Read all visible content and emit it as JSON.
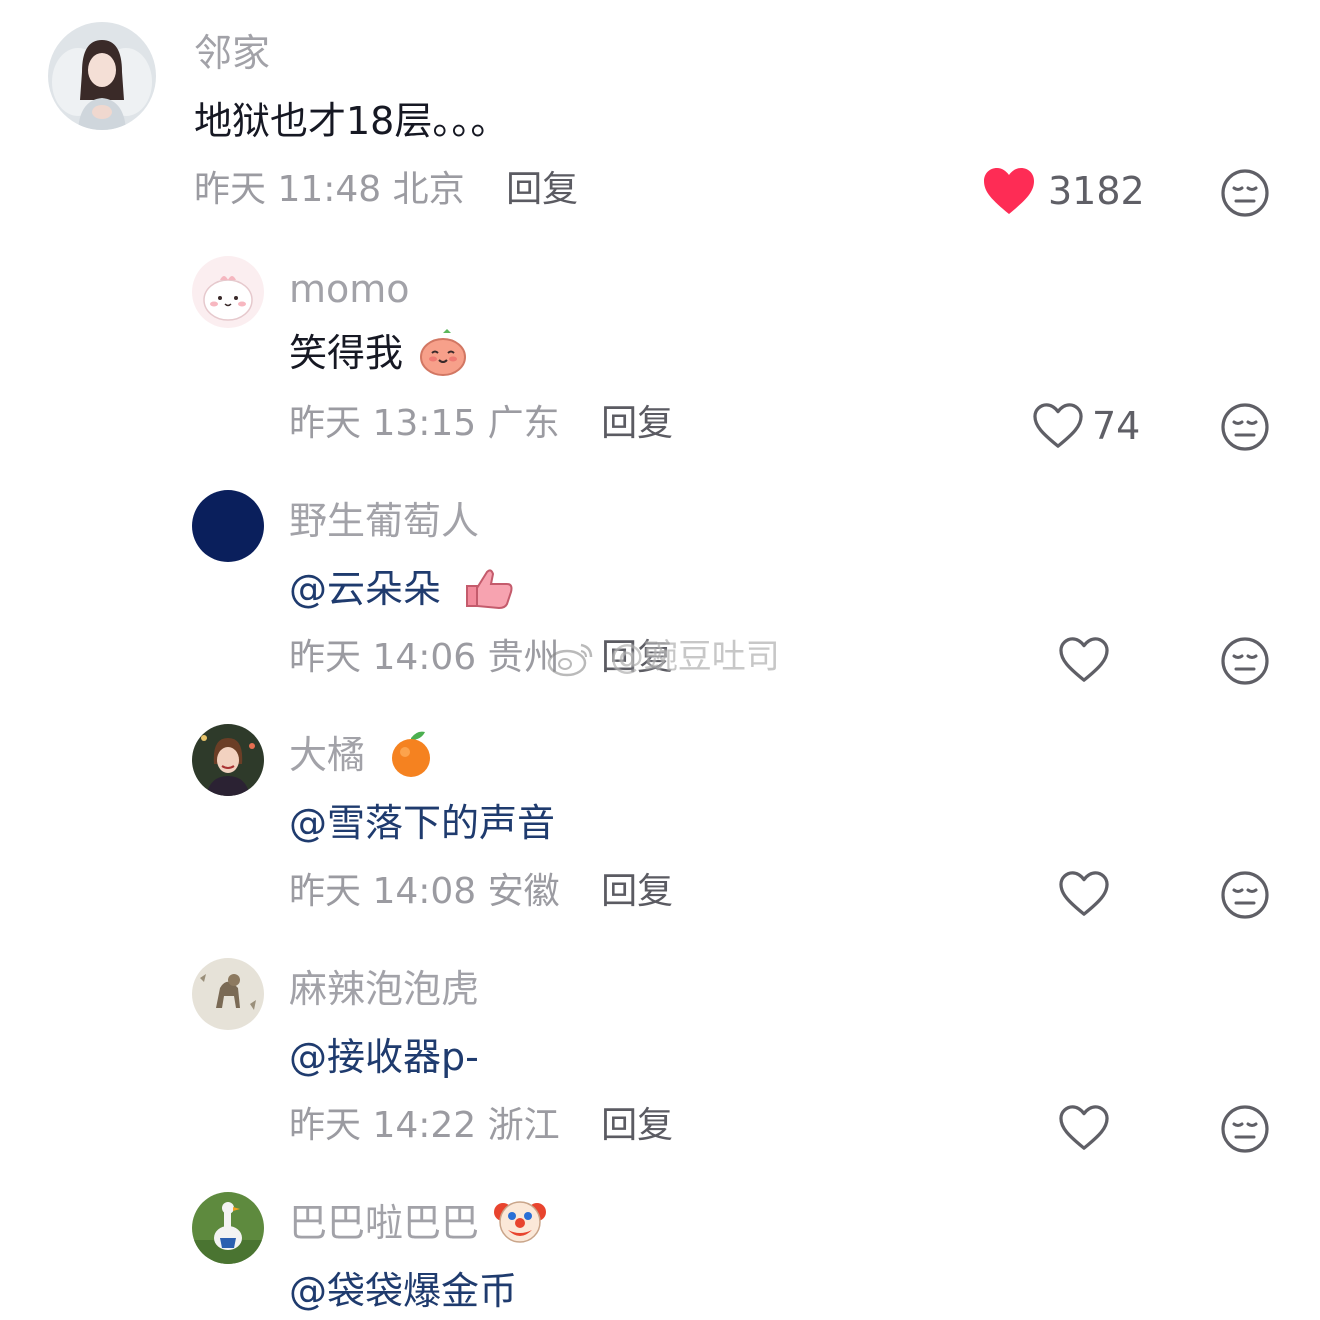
{
  "comments": [
    {
      "username": "邻家",
      "text": "地狱也才18层。。。",
      "time": "昨天 11:48",
      "location": "北京",
      "reply_label": "回复",
      "likes": "3182",
      "liked": true
    },
    {
      "username": "momo",
      "text": "笑得我",
      "time": "昨天 13:15",
      "location": "广东",
      "reply_label": "回复",
      "likes": "74",
      "liked": false
    },
    {
      "username": "野生葡萄人",
      "text": "@云朵朵",
      "time": "昨天 14:06",
      "location": "贵州",
      "reply_label": "回复",
      "likes": "",
      "liked": false
    },
    {
      "username": "大橘",
      "text": "@雪落下的声音",
      "time": "昨天 14:08",
      "location": "安徽",
      "reply_label": "回复",
      "likes": "",
      "liked": false
    },
    {
      "username": "麻辣泡泡虎",
      "text": "@接收器p-",
      "time": "昨天 14:22",
      "location": "浙江",
      "reply_label": "回复",
      "likes": "",
      "liked": false
    },
    {
      "username": "巴巴啦巴巴",
      "text": "@袋袋爆金币"
    }
  ],
  "watermark": "@豌豆吐司",
  "colors": {
    "heart_liked": "#fe2c55",
    "mention": "#1f3b6e",
    "username": "#a2a2a8"
  }
}
